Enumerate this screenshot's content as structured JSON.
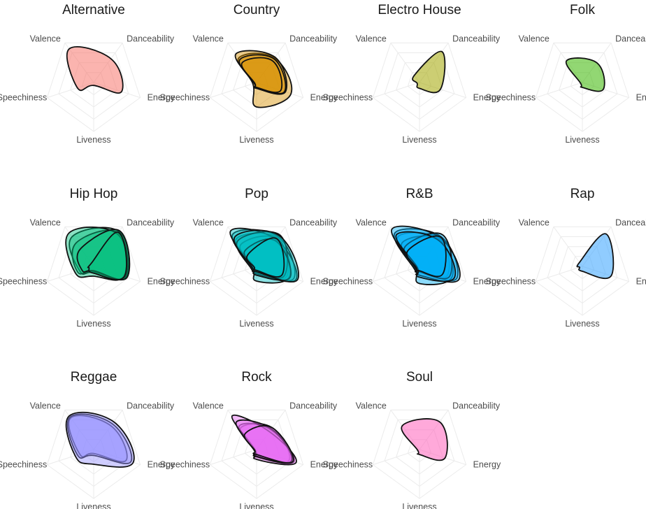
{
  "chart_data": {
    "type": "radar",
    "axes": [
      "Danceability",
      "Energy",
      "Liveness",
      "Speechiness",
      "Valence"
    ],
    "range": [
      0,
      1
    ],
    "panels": [
      {
        "genre": "Alternative",
        "color": "#F8766D",
        "tracks": [
          [
            0.6,
            0.6,
            0.06,
            0.35,
            0.85
          ]
        ]
      },
      {
        "genre": "Country",
        "color": "#D89000",
        "tracks": [
          [
            0.62,
            0.74,
            0.5,
            0.08,
            0.62
          ],
          [
            0.64,
            0.62,
            0.12,
            0.05,
            0.72
          ],
          [
            0.6,
            0.6,
            0.1,
            0.05,
            0.58
          ],
          [
            0.55,
            0.52,
            0.1,
            0.04,
            0.5
          ]
        ]
      },
      {
        "genre": "Electro House",
        "color": "#A3A500",
        "tracks": [
          [
            0.78,
            0.45,
            0.12,
            0.05,
            0.18
          ]
        ]
      },
      {
        "genre": "Folk",
        "color": "#39B600",
        "tracks": [
          [
            0.5,
            0.45,
            0.1,
            0.04,
            0.55
          ]
        ]
      },
      {
        "genre": "Hip Hop",
        "color": "#00BF7D",
        "tracks": [
          [
            0.88,
            0.7,
            0.12,
            0.3,
            0.75
          ],
          [
            0.85,
            0.68,
            0.1,
            0.35,
            0.6
          ],
          [
            0.82,
            0.65,
            0.2,
            0.4,
            0.85
          ],
          [
            0.9,
            0.72,
            0.09,
            0.25,
            0.45
          ],
          [
            0.86,
            0.66,
            0.14,
            0.1,
            0.08
          ]
        ]
      },
      {
        "genre": "Pop",
        "color": "#00BFC4",
        "tracks": [
          [
            0.72,
            0.65,
            0.12,
            0.08,
            0.7
          ],
          [
            0.75,
            0.8,
            0.1,
            0.1,
            0.82
          ],
          [
            0.7,
            0.7,
            0.3,
            0.06,
            0.55
          ],
          [
            0.68,
            0.85,
            0.15,
            0.07,
            0.9
          ],
          [
            0.8,
            0.6,
            0.09,
            0.12,
            0.65
          ],
          [
            0.65,
            0.72,
            0.18,
            0.05,
            0.4
          ],
          [
            0.78,
            0.88,
            0.11,
            0.09,
            0.75
          ],
          [
            0.7,
            0.55,
            0.08,
            0.05,
            0.3
          ]
        ]
      },
      {
        "genre": "R&B",
        "color": "#00B0F6",
        "tracks": [
          [
            0.7,
            0.6,
            0.12,
            0.1,
            0.75
          ],
          [
            0.75,
            0.8,
            0.1,
            0.12,
            0.85
          ],
          [
            0.68,
            0.7,
            0.35,
            0.08,
            0.6
          ],
          [
            0.72,
            0.85,
            0.18,
            0.09,
            0.95
          ],
          [
            0.8,
            0.65,
            0.1,
            0.06,
            0.5
          ],
          [
            0.66,
            0.75,
            0.22,
            0.05,
            0.8
          ],
          [
            0.74,
            0.5,
            0.09,
            0.07,
            0.4
          ]
        ]
      },
      {
        "genre": "Rap",
        "color": "#35A2FF",
        "tracks": [
          [
            0.82,
            0.62,
            0.1,
            0.06,
            0.1
          ]
        ]
      },
      {
        "genre": "Reggae",
        "color": "#9590FF",
        "tracks": [
          [
            0.6,
            0.7,
            0.08,
            0.3,
            0.8
          ],
          [
            0.65,
            0.8,
            0.12,
            0.35,
            0.82
          ],
          [
            0.7,
            0.85,
            0.3,
            0.4,
            0.85
          ]
        ]
      },
      {
        "genre": "Rock",
        "color": "#E76BF3",
        "tracks": [
          [
            0.55,
            0.7,
            0.12,
            0.05,
            0.55
          ],
          [
            0.5,
            0.8,
            0.15,
            0.04,
            0.6
          ],
          [
            0.45,
            0.85,
            0.2,
            0.03,
            0.85
          ],
          [
            0.52,
            0.75,
            0.14,
            0.05,
            0.7
          ],
          [
            0.55,
            0.78,
            0.1,
            0.04,
            0.4
          ]
        ]
      },
      {
        "genre": "Soul",
        "color": "#FF62BC",
        "tracks": [
          [
            0.7,
            0.55,
            0.1,
            0.04,
            0.6
          ]
        ]
      }
    ]
  }
}
